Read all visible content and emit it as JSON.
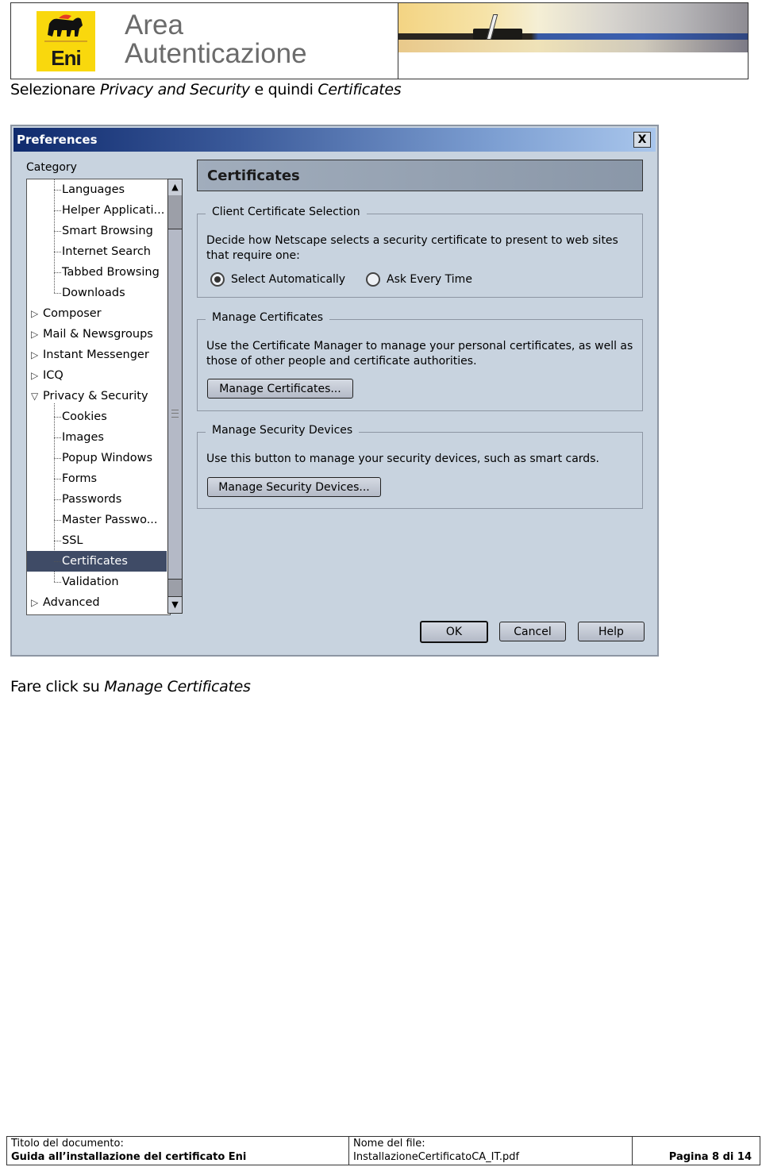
{
  "header": {
    "logo_text": "Eni",
    "logo_icon": "six-legged-dog-icon",
    "area_title_line1": "Area",
    "area_title_line2": "Autenticazione",
    "brand_color": "#f9d80d"
  },
  "instruction1": {
    "prefix": "Selezionare ",
    "em1": "Privacy and Security",
    "middle": " e quindi ",
    "em2": "Certificates"
  },
  "dialog": {
    "title": "Preferences",
    "close_label": "X",
    "category_label": "Category",
    "tree": [
      {
        "label": "Languages",
        "type": "child"
      },
      {
        "label": "Helper Applicati...",
        "type": "child"
      },
      {
        "label": "Smart Browsing",
        "type": "child"
      },
      {
        "label": "Internet Search",
        "type": "child"
      },
      {
        "label": "Tabbed Browsing",
        "type": "child"
      },
      {
        "label": "Downloads",
        "type": "child"
      },
      {
        "label": "Composer",
        "type": "parent",
        "expanded": false
      },
      {
        "label": "Mail & Newsgroups",
        "type": "parent",
        "expanded": false
      },
      {
        "label": "Instant Messenger",
        "type": "parent",
        "expanded": false
      },
      {
        "label": "ICQ",
        "type": "parent",
        "expanded": false
      },
      {
        "label": "Privacy & Security",
        "type": "parent",
        "expanded": true
      },
      {
        "label": "Cookies",
        "type": "child"
      },
      {
        "label": "Images",
        "type": "child"
      },
      {
        "label": "Popup Windows",
        "type": "child"
      },
      {
        "label": "Forms",
        "type": "child"
      },
      {
        "label": "Passwords",
        "type": "child"
      },
      {
        "label": "Master Passwo...",
        "type": "child"
      },
      {
        "label": "SSL",
        "type": "child"
      },
      {
        "label": "Certificates",
        "type": "child",
        "selected": true
      },
      {
        "label": "Validation",
        "type": "child"
      },
      {
        "label": "Advanced",
        "type": "parent",
        "expanded": false
      }
    ],
    "panel_title": "Certificates",
    "client_cert": {
      "legend": "Client Certificate Selection",
      "text": "Decide how Netscape selects a security certificate to present to web sites that require one:",
      "options": [
        {
          "label": "Select Automatically",
          "checked": true
        },
        {
          "label": "Ask Every Time",
          "checked": false
        }
      ]
    },
    "manage_certs": {
      "legend": "Manage Certificates",
      "text": "Use the Certificate Manager to manage your personal certificates, as well as those of other people and certificate authorities.",
      "button": "Manage Certificates..."
    },
    "security_devices": {
      "legend": "Manage Security Devices",
      "text": "Use this button to manage your security devices, such as smart cards.",
      "button": "Manage Security Devices..."
    },
    "buttons": {
      "ok": "OK",
      "cancel": "Cancel",
      "help": "Help"
    }
  },
  "instruction2": {
    "prefix": "Fare click su ",
    "em": "Manage Certificates"
  },
  "footer": {
    "doc_title_label": "Titolo del documento:",
    "doc_title": "Guida all’installazione del certificato Eni",
    "file_label": "Nome del file:",
    "file_name": "InstallazioneCertificatoCA_IT.pdf",
    "page": "Pagina 8 di 14"
  }
}
